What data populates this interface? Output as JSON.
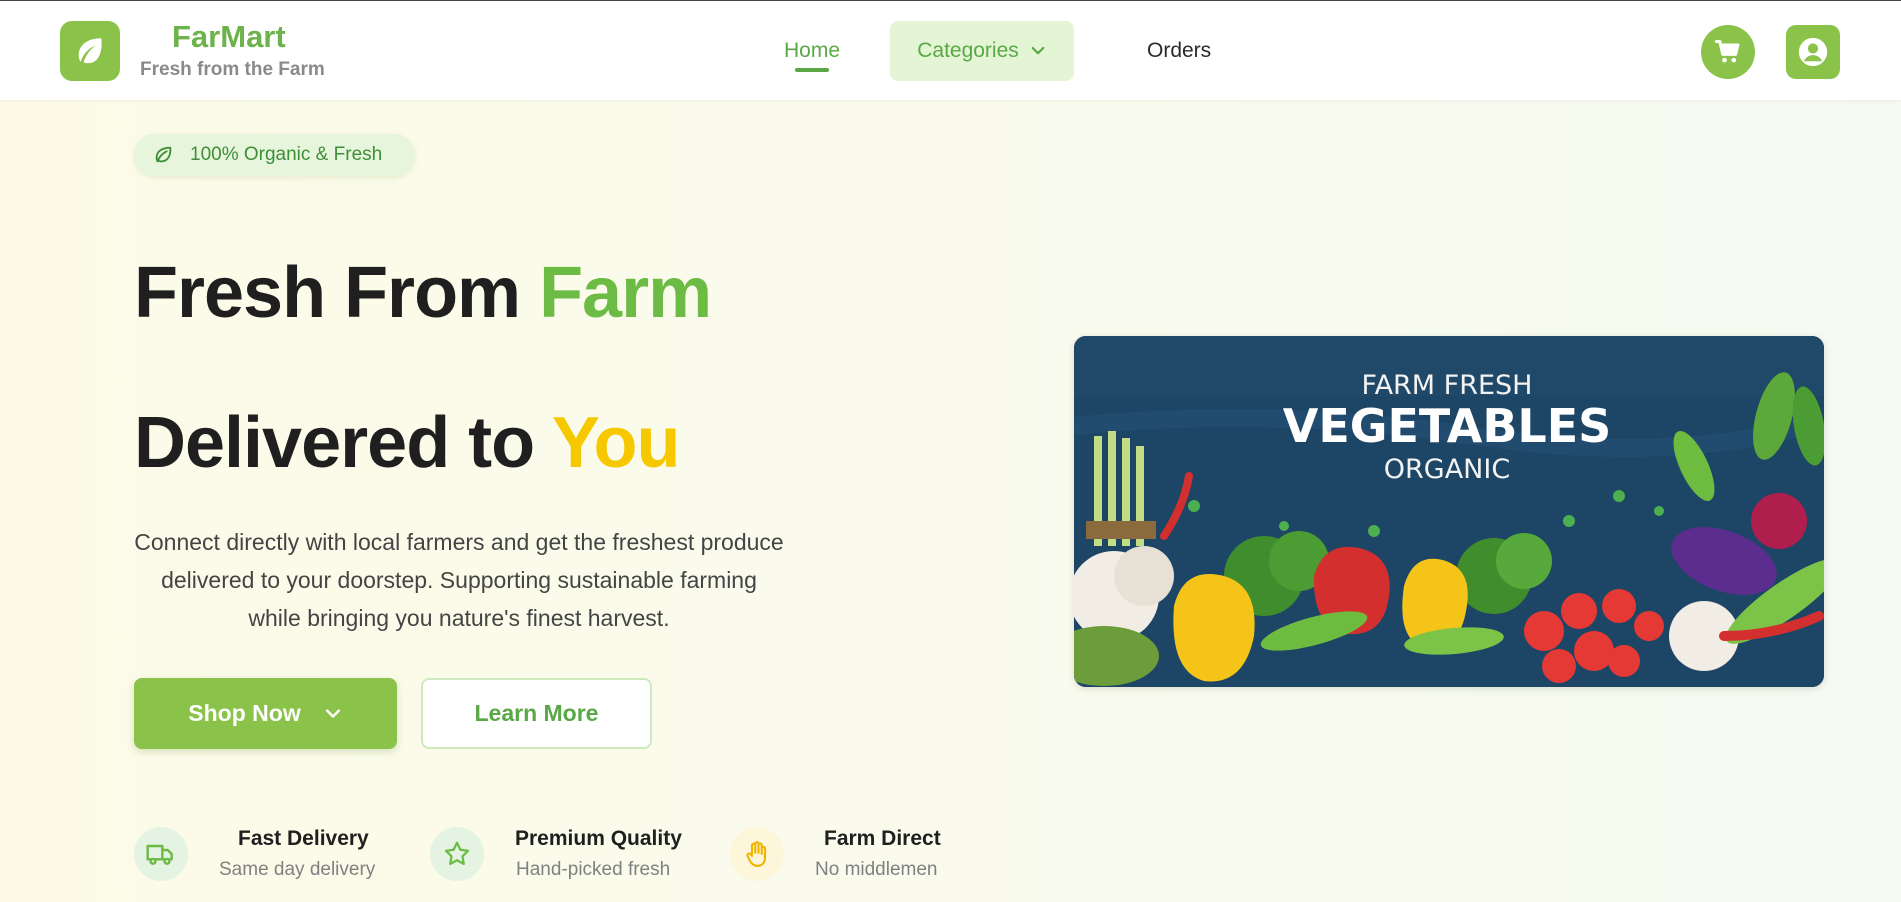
{
  "brand": {
    "name": "FarMart",
    "tagline": "Fresh from the Farm",
    "logo_icon": "leaf-icon"
  },
  "nav": {
    "home": "Home",
    "categories": "Categories",
    "orders": "Orders",
    "active": "Home"
  },
  "header_actions": {
    "cart_icon": "cart-icon",
    "account_icon": "user-icon"
  },
  "hero": {
    "badge": "100% Organic & Fresh",
    "title_line1_a": "Fresh From ",
    "title_line1_b": "Farm",
    "title_line2_a": "Delivered to ",
    "title_line2_b": "You",
    "description": "Connect directly with local farmers and get the freshest produce delivered to your doorstep. Supporting sustainable farming while bringing you nature's finest harvest.",
    "primary_button": "Shop Now",
    "secondary_button": "Learn More"
  },
  "banner": {
    "line1": "FARM FRESH",
    "line2": "VEGETABLES",
    "line3": "ORGANIC"
  },
  "features": [
    {
      "title": "Fast Delivery",
      "subtitle": "Same day delivery",
      "icon": "truck-icon"
    },
    {
      "title": "Premium Quality",
      "subtitle": "Hand-picked fresh",
      "icon": "star-icon"
    },
    {
      "title": "Farm Direct",
      "subtitle": "No middlemen",
      "icon": "hand-icon"
    }
  ],
  "colors": {
    "primary": "#8bc34a",
    "primary_dark": "#5aa845",
    "accent_yellow": "#f6c800",
    "banner_bg": "#1d4565"
  }
}
